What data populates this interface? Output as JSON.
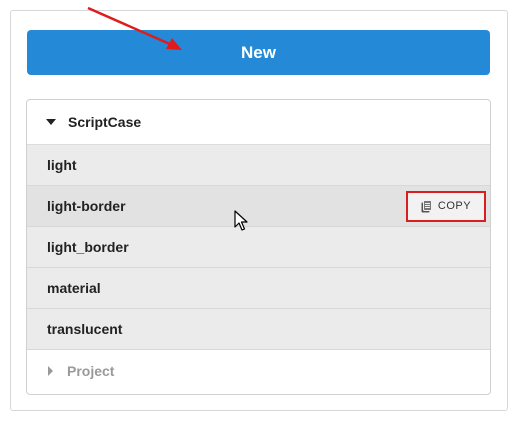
{
  "new_button": {
    "label": "New"
  },
  "group": {
    "title": "ScriptCase",
    "items": [
      {
        "label": "light"
      },
      {
        "label": "light-border"
      },
      {
        "label": "light_border"
      },
      {
        "label": "material"
      },
      {
        "label": "translucent"
      }
    ]
  },
  "copy_button": {
    "label": "COPY"
  },
  "collapsed_group": {
    "title": "Project"
  },
  "colors": {
    "accent": "#2489d6",
    "annotation": "#d81e1e",
    "row_bg": "#ebebeb"
  },
  "icons": [
    "caret-down-icon",
    "copy-icon",
    "caret-right-icon",
    "mouse-cursor-icon",
    "annotation-arrow-icon"
  ]
}
